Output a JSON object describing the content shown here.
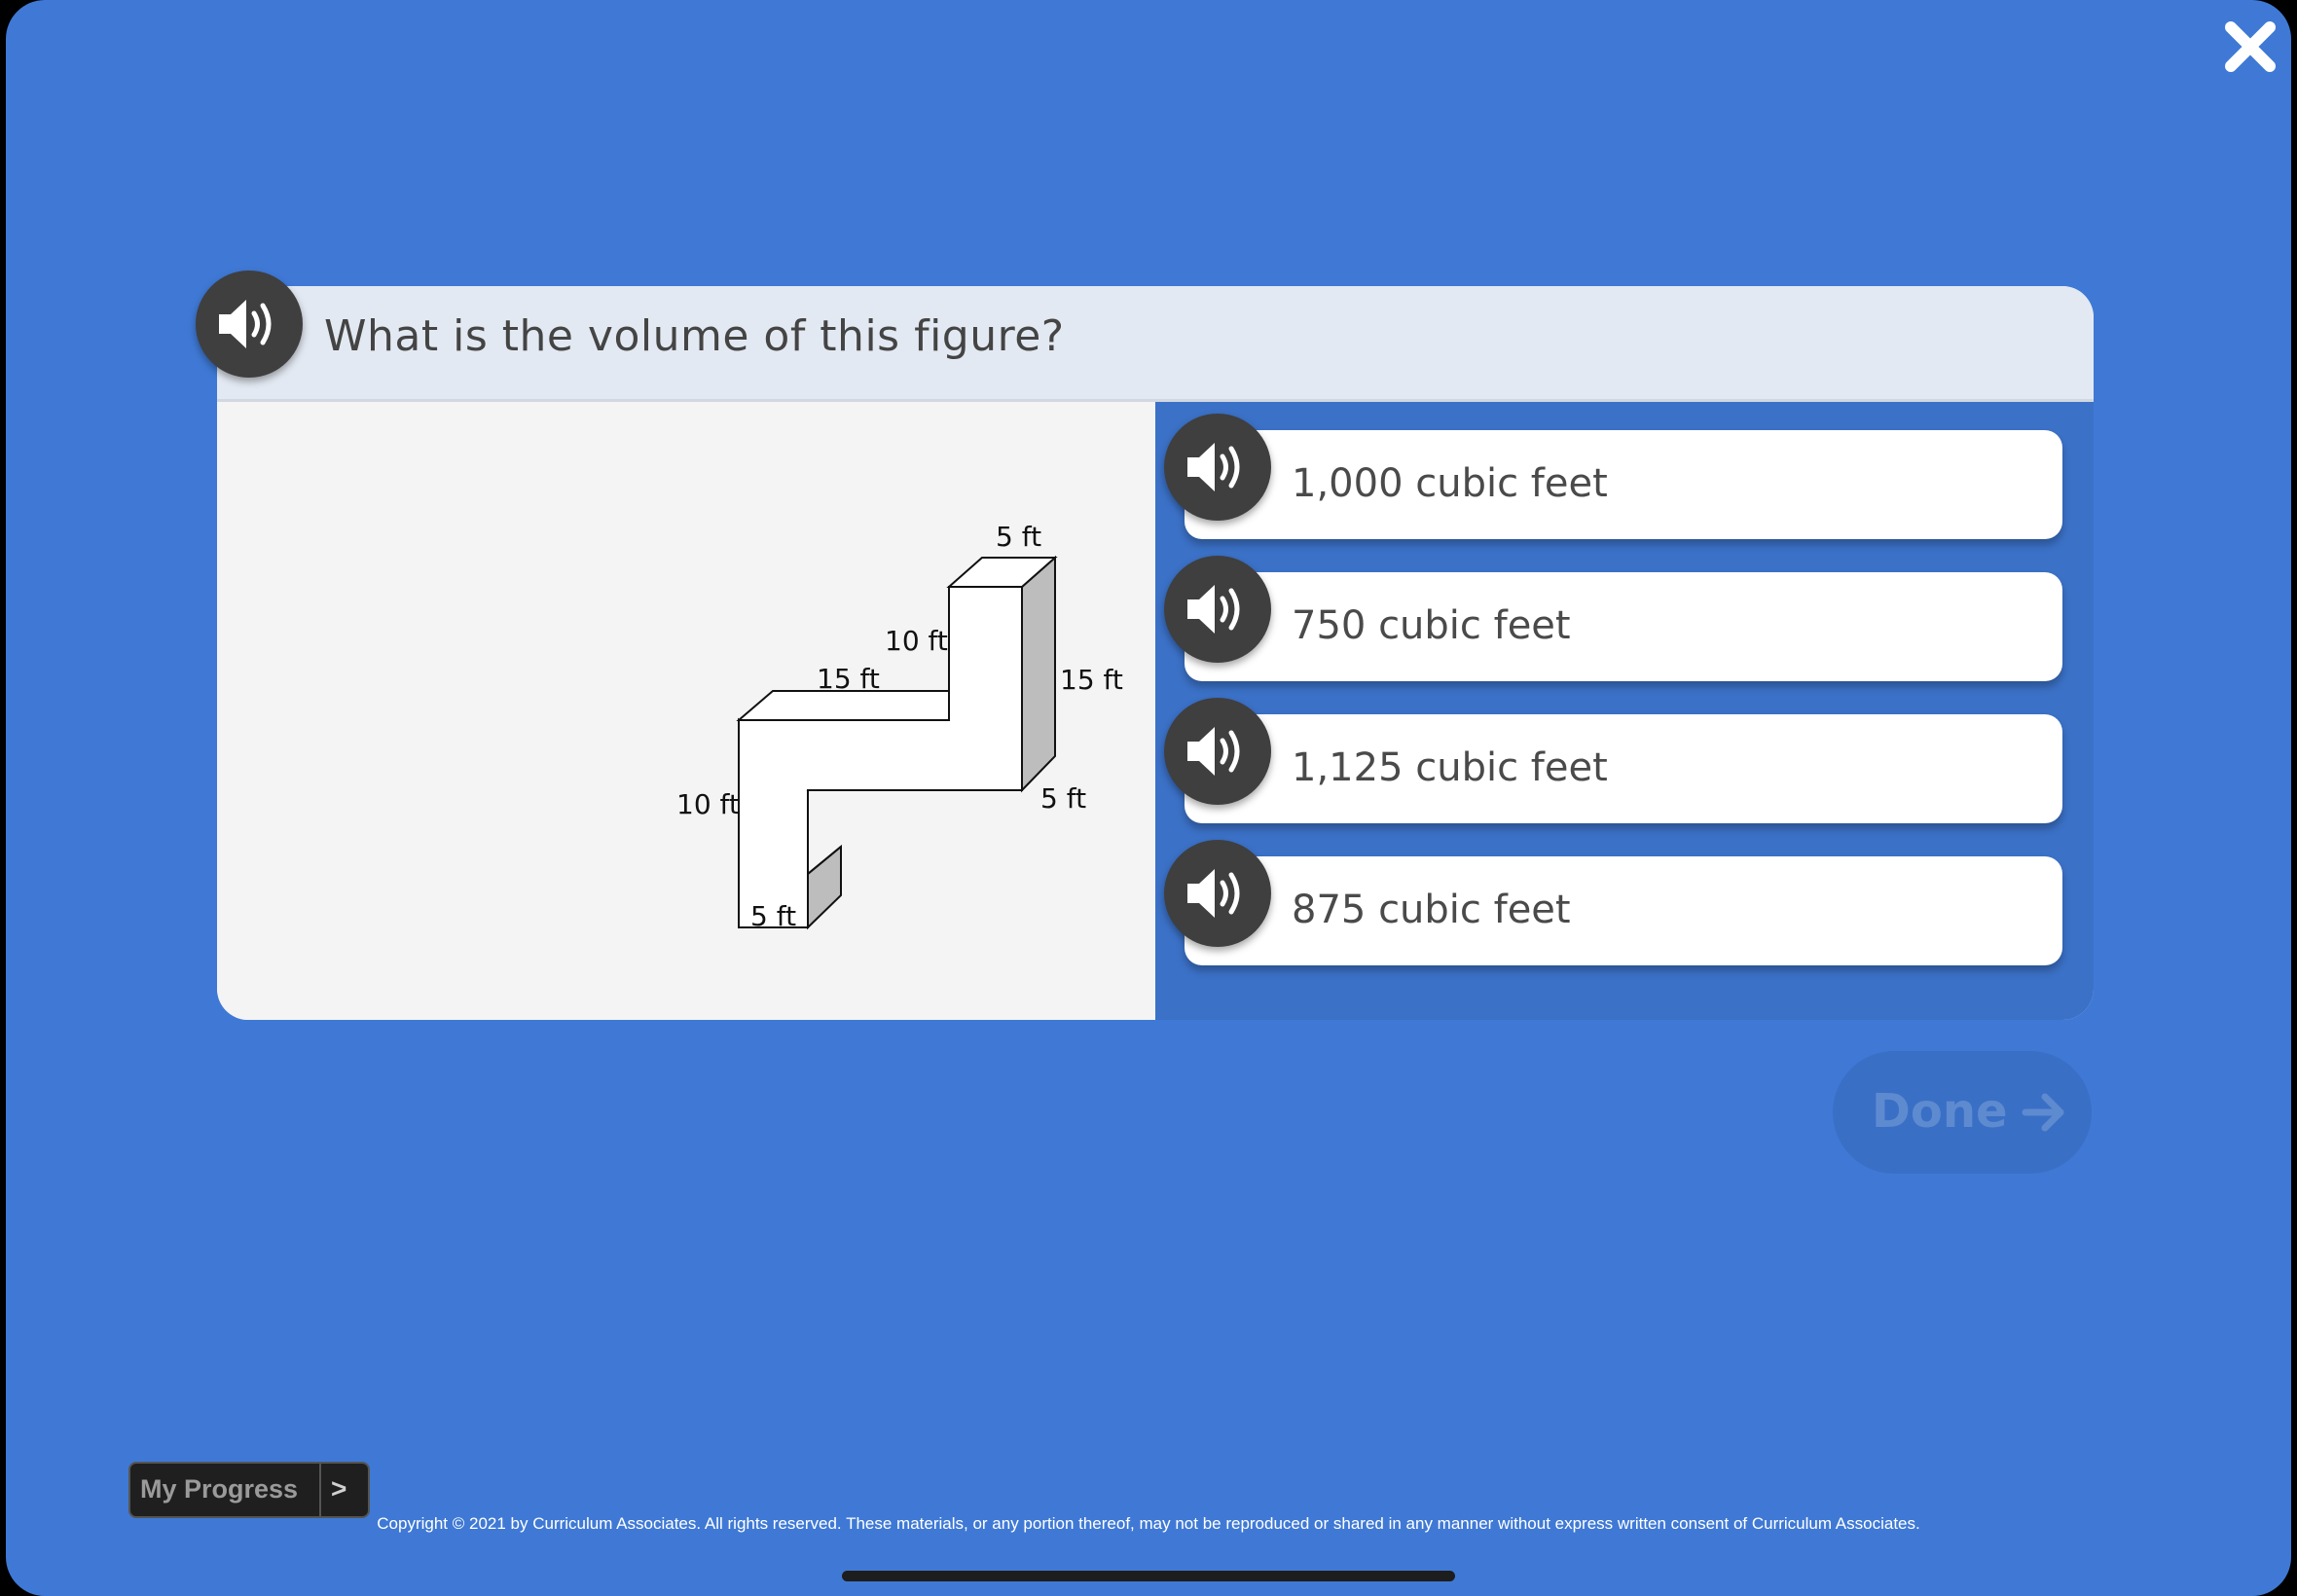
{
  "question": {
    "text": "What is the volume of this figure?",
    "audio_icon": "speaker-icon"
  },
  "figure": {
    "labels": {
      "top_width": "5 ft",
      "upper_left_height": "10 ft",
      "upper_right_height": "15 ft",
      "middle_length": "15 ft",
      "lower_left_height": "10 ft",
      "lower_right_depth": "5 ft",
      "bottom_width": "5 ft"
    }
  },
  "answers": [
    {
      "label": "1,000 cubic feet"
    },
    {
      "label": "750 cubic feet"
    },
    {
      "label": "1,125 cubic feet"
    },
    {
      "label": "875 cubic feet"
    }
  ],
  "done_button": {
    "label": "Done",
    "icon": "arrow-right-icon"
  },
  "progress_button": {
    "label": "My Progress",
    "chevron": ">"
  },
  "copyright": "Copyright © 2021 by Curriculum Associates. All rights reserved. These materials, or any portion thereof, may not be reproduced or shared in any manner without express written consent of Curriculum Associates.",
  "colors": {
    "background": "#3f79d5",
    "answers_panel": "#3b71c7",
    "question_bar": "#e3e9f2",
    "speaker_button": "#3f3f3f"
  }
}
